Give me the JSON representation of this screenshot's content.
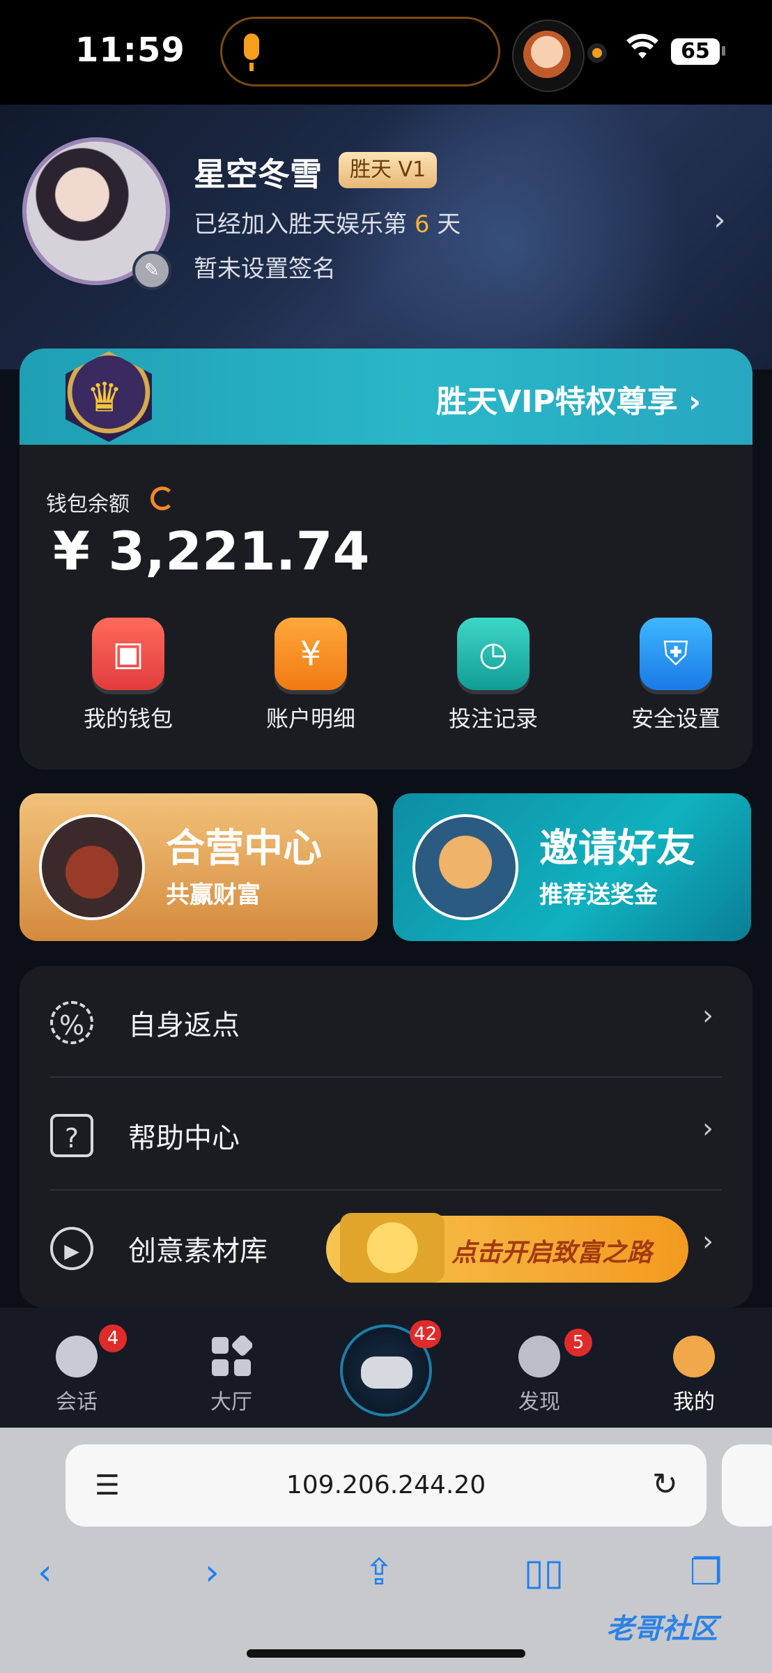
{
  "status_bar": {
    "time": "11:59",
    "battery": "65",
    "wifi_icon": "wifi-icon",
    "mic_icon": "mic-icon"
  },
  "profile": {
    "username": "星空冬雪",
    "level_badge": "胜天 V1",
    "joined_prefix": "已经加入胜天娱乐第",
    "joined_days": "6",
    "joined_suffix": "天",
    "signature": "暂未设置签名"
  },
  "vip": {
    "label": "胜天VIP特权尊享",
    "icon": "crown-icon"
  },
  "wallet": {
    "balance_label": "钱包余额",
    "balance": "¥ 3,221.74",
    "shortcuts": [
      {
        "label": "我的钱包",
        "icon": "wallet-icon",
        "color": "#e23d3d"
      },
      {
        "label": "账户明细",
        "icon": "account-detail-icon",
        "color": "#f07a12"
      },
      {
        "label": "投注记录",
        "icon": "bet-record-icon",
        "color": "#119c95"
      },
      {
        "label": "安全设置",
        "icon": "shield-icon",
        "color": "#1a79e6"
      }
    ]
  },
  "promos": [
    {
      "title": "合营中心",
      "subtitle": "共赢财富"
    },
    {
      "title": "邀请好友",
      "subtitle": "推荐送奖金"
    }
  ],
  "menu": [
    {
      "label": "自身返点",
      "icon": "rebate-percent-icon"
    },
    {
      "label": "帮助中心",
      "icon": "help-icon"
    },
    {
      "label": "创意素材库",
      "icon": "play-icon",
      "banner_text": "点击开启致富之路"
    }
  ],
  "tabs": [
    {
      "label": "会话",
      "badge": "4",
      "icon": "chat-icon"
    },
    {
      "label": "大厅",
      "badge": "",
      "icon": "lobby-grid-icon"
    },
    {
      "label": "",
      "badge": "42",
      "icon": "gamepad-icon"
    },
    {
      "label": "发现",
      "badge": "5",
      "icon": "compass-icon"
    },
    {
      "label": "我的",
      "badge": "",
      "icon": "profile-icon",
      "active": true
    }
  ],
  "browser": {
    "url": "109.206.244.20",
    "toolbar": [
      "back-icon",
      "forward-icon",
      "share-icon",
      "bookmarks-icon",
      "tabs-icon"
    ]
  },
  "watermark": "老哥社区"
}
